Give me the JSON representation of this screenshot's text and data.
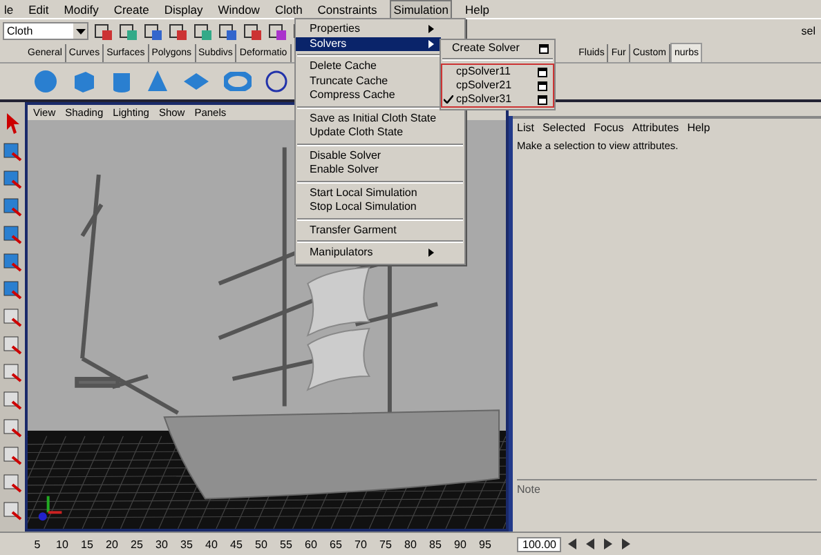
{
  "menubar": [
    {
      "label": "le",
      "selected": false
    },
    {
      "label": "Edit",
      "selected": false
    },
    {
      "label": "Modify",
      "selected": false
    },
    {
      "label": "Create",
      "selected": false
    },
    {
      "label": "Display",
      "selected": false
    },
    {
      "label": "Window",
      "selected": false
    },
    {
      "label": "Cloth",
      "selected": false
    },
    {
      "label": "Constraints",
      "selected": false
    },
    {
      "label": "Simulation",
      "selected": true
    },
    {
      "label": "Help",
      "selected": false
    }
  ],
  "toolbar": {
    "menu_set": "Cloth",
    "selection_field": "sel"
  },
  "shelf_tabs": [
    {
      "label": "General",
      "selected": false
    },
    {
      "label": "Curves",
      "selected": false
    },
    {
      "label": "Surfaces",
      "selected": false
    },
    {
      "label": "Polygons",
      "selected": false
    },
    {
      "label": "Subdivs",
      "selected": false
    },
    {
      "label": "Deformatio",
      "selected": false
    },
    {
      "label": "Fluids",
      "selected": false
    },
    {
      "label": "Fur",
      "selected": false
    },
    {
      "label": "Custom",
      "selected": false
    },
    {
      "label": "nurbs",
      "selected": true
    }
  ],
  "simulation_menu": {
    "sections": [
      [
        {
          "label": "Properties",
          "submenu": true,
          "selected": false
        },
        {
          "label": "Solvers",
          "submenu": true,
          "selected": true
        }
      ],
      [
        {
          "label": "Delete Cache",
          "submenu": false,
          "selected": false
        },
        {
          "label": "Truncate Cache",
          "submenu": false,
          "selected": false
        },
        {
          "label": "Compress Cache",
          "submenu": false,
          "selected": false
        }
      ],
      [
        {
          "label": "Save as Initial Cloth State",
          "submenu": false,
          "selected": false
        },
        {
          "label": "Update Cloth State",
          "submenu": false,
          "selected": false
        }
      ],
      [
        {
          "label": "Disable Solver",
          "submenu": false,
          "selected": false
        },
        {
          "label": "Enable Solver",
          "submenu": false,
          "selected": false
        }
      ],
      [
        {
          "label": "Start Local Simulation",
          "submenu": false,
          "selected": false
        },
        {
          "label": "Stop Local Simulation",
          "submenu": false,
          "selected": false
        }
      ],
      [
        {
          "label": "Transfer Garment",
          "submenu": false,
          "selected": false
        }
      ],
      [
        {
          "label": "Manipulators",
          "submenu": true,
          "selected": false
        }
      ]
    ]
  },
  "solvers_submenu": {
    "create": "Create Solver",
    "solvers": [
      {
        "label": "cpSolver11",
        "checked": false
      },
      {
        "label": "cpSolver21",
        "checked": false
      },
      {
        "label": "cpSolver31",
        "checked": true
      }
    ]
  },
  "viewport": {
    "menu": [
      "View",
      "Shading",
      "Lighting",
      "Show",
      "Panels"
    ]
  },
  "attribute_editor": {
    "menu": [
      "List",
      "Selected",
      "Focus",
      "Attributes",
      "Help"
    ],
    "message": "Make a selection to view attributes.",
    "notes_label": "Note"
  },
  "timeline": {
    "ticks": [
      "5",
      "10",
      "15",
      "20",
      "25",
      "30",
      "35",
      "40",
      "45",
      "50",
      "55",
      "60",
      "65",
      "70",
      "75",
      "80",
      "85",
      "90",
      "95"
    ],
    "current_frame": "100.00"
  }
}
